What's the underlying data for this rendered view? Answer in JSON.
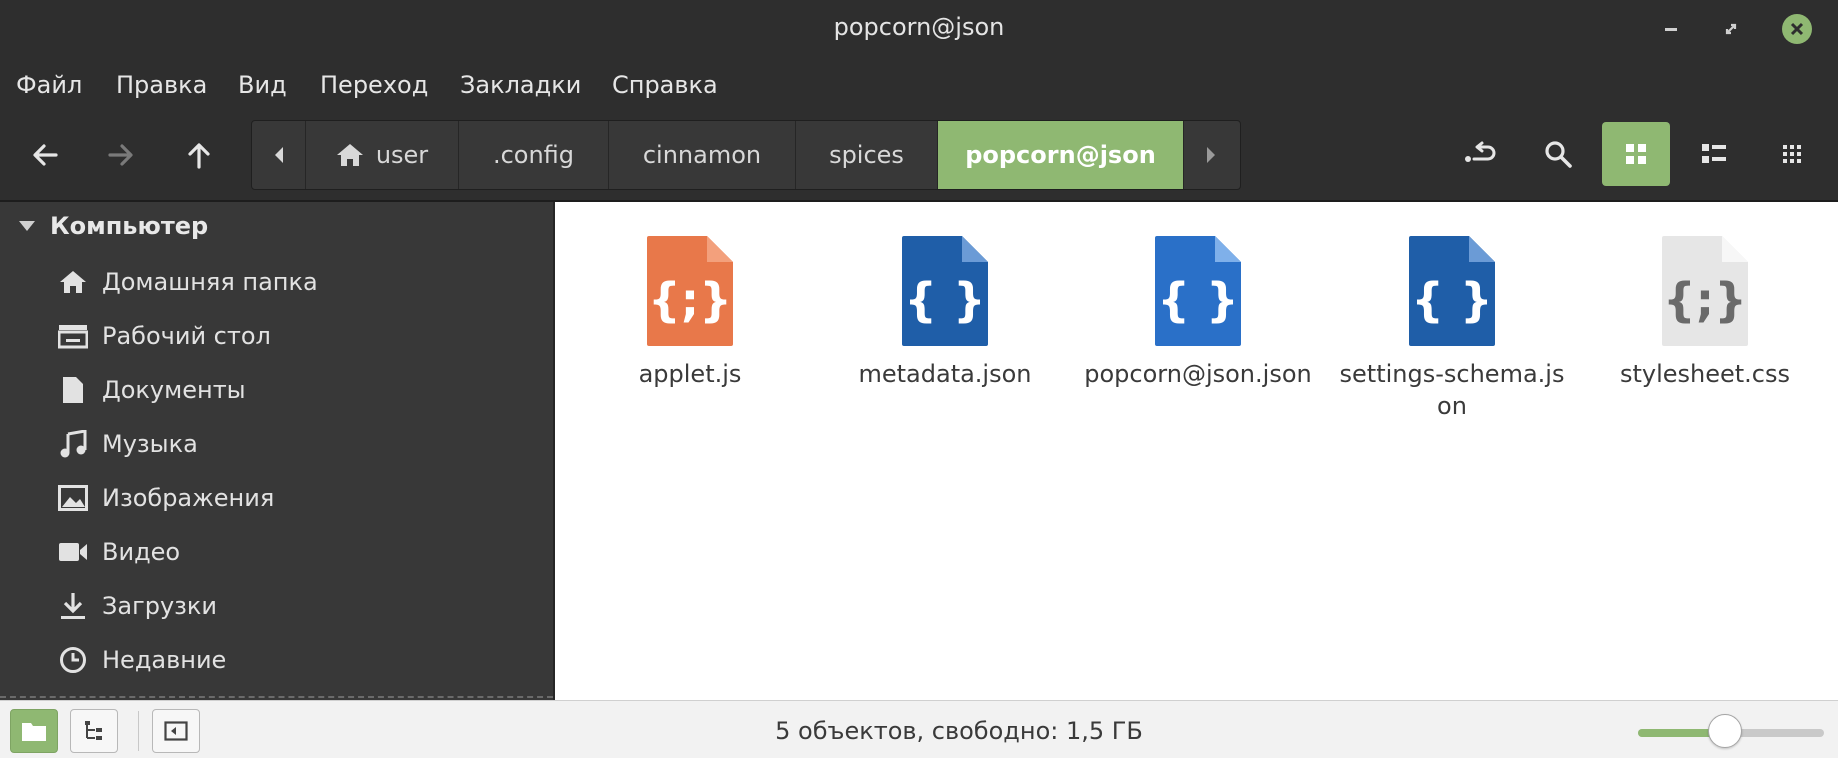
{
  "window": {
    "title": "popcorn@json"
  },
  "menu": [
    "Файл",
    "Правка",
    "Вид",
    "Переход",
    "Закладки",
    "Справка"
  ],
  "pathbar": {
    "segments": [
      "user",
      ".config",
      "cinnamon",
      "spices",
      "popcorn@json"
    ]
  },
  "sidebar": {
    "header": "Компьютер",
    "items": [
      {
        "label": "Домашняя папка",
        "icon": "home-icon"
      },
      {
        "label": "Рабочий стол",
        "icon": "desktop-icon"
      },
      {
        "label": "Документы",
        "icon": "document-icon"
      },
      {
        "label": "Музыка",
        "icon": "music-icon"
      },
      {
        "label": "Изображения",
        "icon": "image-icon"
      },
      {
        "label": "Видео",
        "icon": "video-icon"
      },
      {
        "label": "Загрузки",
        "icon": "download-icon"
      },
      {
        "label": "Недавние",
        "icon": "recent-icon"
      }
    ]
  },
  "files": [
    {
      "name": "applet.js",
      "icon": "javascript-file-icon",
      "color": "#e8784a"
    },
    {
      "name": "metadata.json",
      "icon": "json-file-icon",
      "color": "#1f5ea8"
    },
    {
      "name": "popcorn@json.json",
      "icon": "json-file-icon",
      "color": "#2a70c8"
    },
    {
      "name": "settings-schema.json",
      "icon": "json-file-icon",
      "color": "#1f5ea8"
    },
    {
      "name": "stylesheet.css",
      "icon": "css-file-icon",
      "color": "#e6e6e6"
    }
  ],
  "status": {
    "text": "5 объектов, свободно: 1,5 ГБ",
    "zoom_level": 0.47
  },
  "colors": {
    "accent": "#8fb872",
    "chrome": "#2e2e2e",
    "sidebar": "#383838"
  }
}
